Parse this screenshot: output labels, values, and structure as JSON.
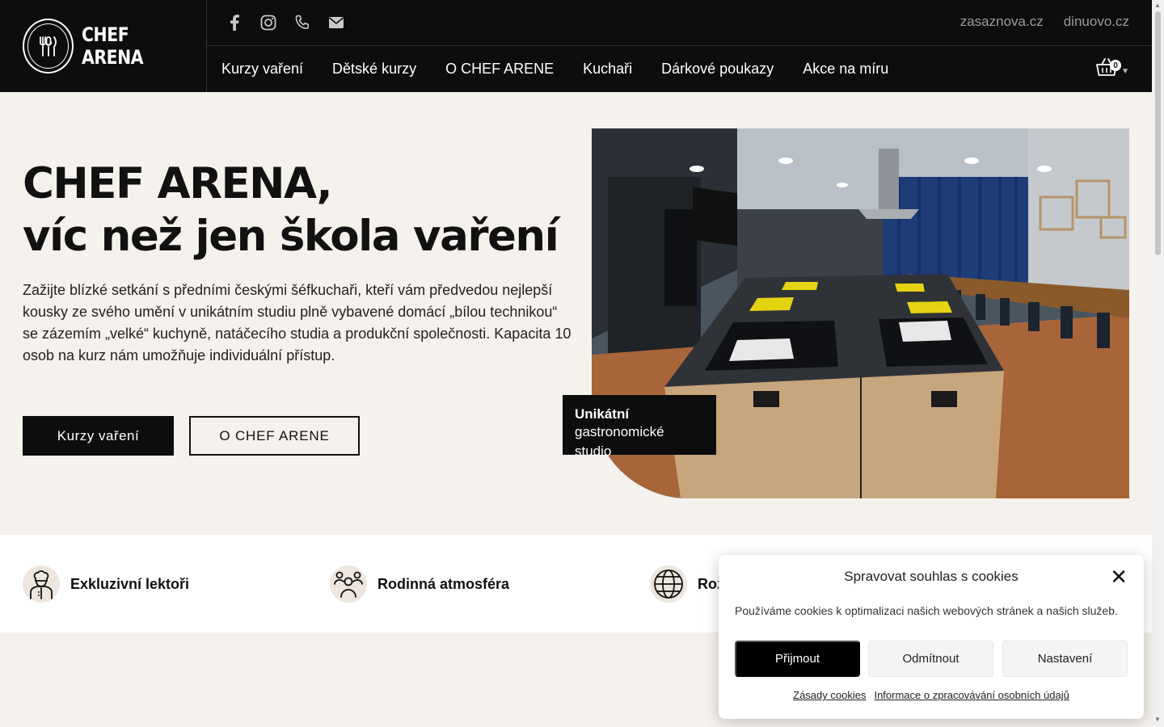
{
  "header": {
    "logo_text": "CHEF ARENA",
    "social": [
      "facebook-icon",
      "instagram-icon",
      "phone-icon",
      "mail-icon"
    ],
    "top_links": [
      "zasaznova.cz",
      "dinuovo.cz"
    ],
    "nav": [
      "Kurzy vaření",
      "Dětské kurzy",
      "O CHEF ARENE",
      "Kuchaři",
      "Dárkové poukazy",
      "Akce na míru"
    ],
    "cart_count": "0"
  },
  "hero": {
    "title_line1": "CHEF ARENA,",
    "title_line2": "víc než jen škola vaření",
    "description": "Zažijte blízké setkání s předními českými šéfkuchaři, kteří vám předvedou nejlepší kousky ze svého umění v unikátním studiu plně vybavené domácí „bílou technikou“ se zázemím „velké“ kuchyně, natáčecího studia a produkční společnosti. Kapacita 10 osob na kurz nám umožňuje individuální přístup.",
    "primary_button": "Kurzy vaření",
    "secondary_button": "O CHEF ARENE",
    "badge_title": "Unikátní",
    "badge_subtitle": "gastronomické studio"
  },
  "features": [
    {
      "label": "Exkluzivní lektoři",
      "icon": "chef-icon"
    },
    {
      "label": "Rodinná atmosféra",
      "icon": "people-icon"
    },
    {
      "label": "Roz",
      "icon": "globe-icon"
    }
  ],
  "cookie": {
    "title": "Spravovat souhlas s cookies",
    "text": "Používáme cookies k optimalizaci našich webových stránek a našich služeb.",
    "accept": "Přijmout",
    "deny": "Odmítnout",
    "settings": "Nastavení",
    "link_policy": "Zásady cookies",
    "link_privacy": "Informace o zpracovávání osobních údajů"
  }
}
